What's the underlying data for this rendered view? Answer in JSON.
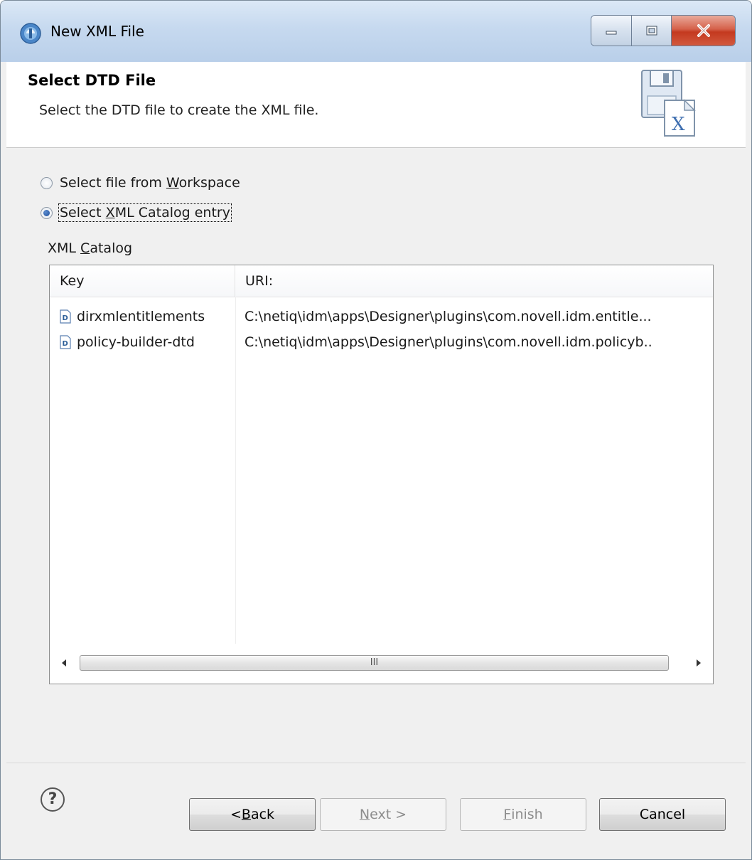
{
  "window": {
    "title": "New XML File",
    "icon": "eclipse-icon"
  },
  "banner": {
    "title": "Select DTD File",
    "description": "Select the DTD file to create the XML file.",
    "icon": "save-xml-wizard-icon"
  },
  "source_options": [
    {
      "pre": "Select file from ",
      "mnemonic": "W",
      "post": "orkspace",
      "selected": false
    },
    {
      "pre": "Select ",
      "mnemonic": "X",
      "post": "ML Catalog entry",
      "selected": true
    }
  ],
  "catalog": {
    "label_pre": "XML ",
    "label_mnemonic": "C",
    "label_post": "atalog",
    "columns": {
      "key": "Key",
      "uri": "URI:"
    },
    "rows": [
      {
        "key": "dirxmlentitlements",
        "uri": "C:\\netiq\\idm\\apps\\Designer\\plugins\\com.novell.idm.entitle..."
      },
      {
        "key": "policy-builder-dtd",
        "uri": "C:\\netiq\\idm\\apps\\Designer\\plugins\\com.novell.idm.policyb.."
      }
    ],
    "scroll_thumb_grip": "III"
  },
  "buttons": {
    "help": "?",
    "back": {
      "pre": "< ",
      "mnemonic": "B",
      "post": "ack"
    },
    "next": {
      "pre": "",
      "mnemonic": "N",
      "post": "ext >"
    },
    "finish": {
      "pre": "",
      "mnemonic": "F",
      "post": "inish"
    },
    "cancel": "Cancel"
  }
}
